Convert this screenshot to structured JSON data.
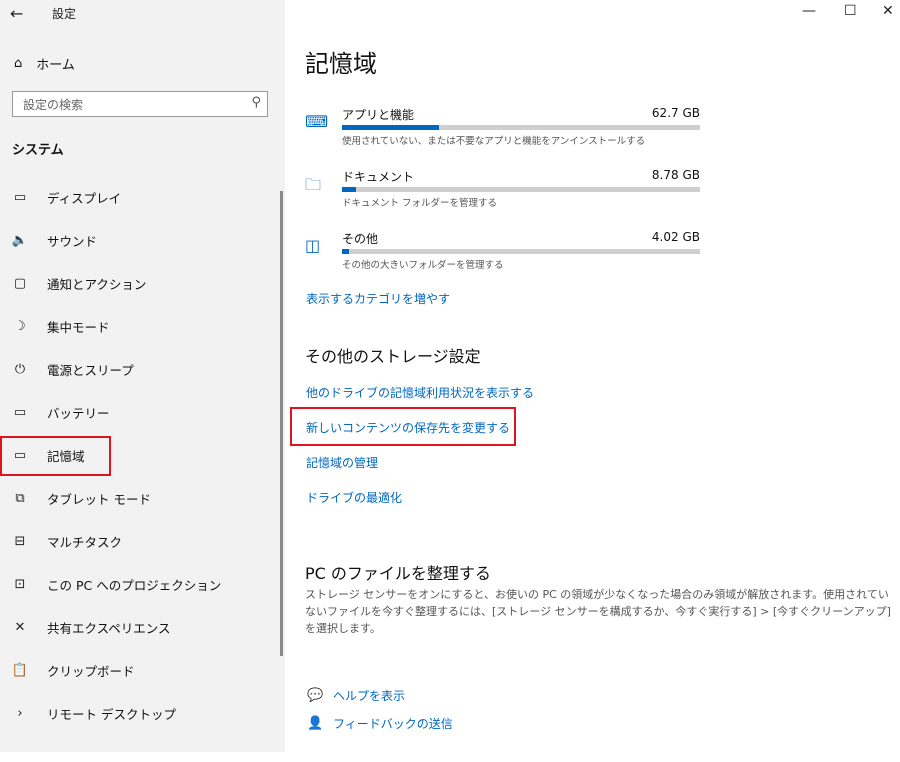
{
  "window": {
    "title": "設定",
    "controls": [
      "—",
      "☐",
      "✕"
    ]
  },
  "sidebar": {
    "back_glyph": "←",
    "home_label": "ホーム",
    "search_placeholder": "設定の検索",
    "section_label": "システム",
    "items": [
      {
        "label": "ディスプレイ",
        "icon": "monitor-icon",
        "glyph": "▭"
      },
      {
        "label": "サウンド",
        "icon": "speaker-icon",
        "glyph": "🔈"
      },
      {
        "label": "通知とアクション",
        "icon": "message-icon",
        "glyph": "▢"
      },
      {
        "label": "集中モード",
        "icon": "moon-icon",
        "glyph": "☽"
      },
      {
        "label": "電源とスリープ",
        "icon": "power-icon",
        "glyph": "⏻"
      },
      {
        "label": "バッテリー",
        "icon": "battery-icon",
        "glyph": "▭"
      },
      {
        "label": "記憶域",
        "icon": "storage-icon",
        "glyph": "▭"
      },
      {
        "label": "タブレット モード",
        "icon": "tablet-icon",
        "glyph": "⧉"
      },
      {
        "label": "マルチタスク",
        "icon": "multitask-icon",
        "glyph": "⊟"
      },
      {
        "label": "この PC へのプロジェクション",
        "icon": "projection-icon",
        "glyph": "⊡"
      },
      {
        "label": "共有エクスペリエンス",
        "icon": "share-icon",
        "glyph": "✕"
      },
      {
        "label": "クリップボード",
        "icon": "clipboard-icon",
        "glyph": "📋"
      },
      {
        "label": "リモート デスクトップ",
        "icon": "remote-icon",
        "glyph": "›"
      }
    ]
  },
  "main": {
    "title": "記憶域",
    "categories": [
      {
        "name": "アプリと機能",
        "size": "62.7 GB",
        "desc": "使用されていない、または不要なアプリと機能をアンインストールする",
        "fill": 0.27,
        "icon": "keyboard-icon",
        "glyph": "⌨"
      },
      {
        "name": "ドキュメント",
        "size": "8.78 GB",
        "desc": "ドキュメント フォルダーを管理する",
        "fill": 0.04,
        "icon": "documents-icon",
        "glyph": "🗀"
      },
      {
        "name": "その他",
        "size": "4.02 GB",
        "desc": "その他の大きいフォルダーを管理する",
        "fill": 0.02,
        "icon": "other-folder-icon",
        "glyph": "◫"
      }
    ],
    "more_categories_link": "表示するカテゴリを増やす",
    "other_storage_heading": "その他のストレージ設定",
    "links": [
      "他のドライブの記憶域利用状況を表示する",
      "新しいコンテンツの保存先を変更する",
      "記憶域の管理",
      "ドライブの最適化"
    ],
    "organize_heading": "PC のファイルを整理する",
    "organize_text": "ストレージ センサーをオンにすると、お使いの PC の領域が少なくなった場合のみ領域が解放されます。使用されていないファイルを今すぐ整理するには、[ストレージ センサーを構成するか、今すぐ実行する] > [今すぐクリーンアップ] を選択します。",
    "help_label": "ヘルプを表示",
    "feedback_label": "フィードバックの送信"
  },
  "accent_color": "#0067c0",
  "highlight_color": "#e0141c"
}
